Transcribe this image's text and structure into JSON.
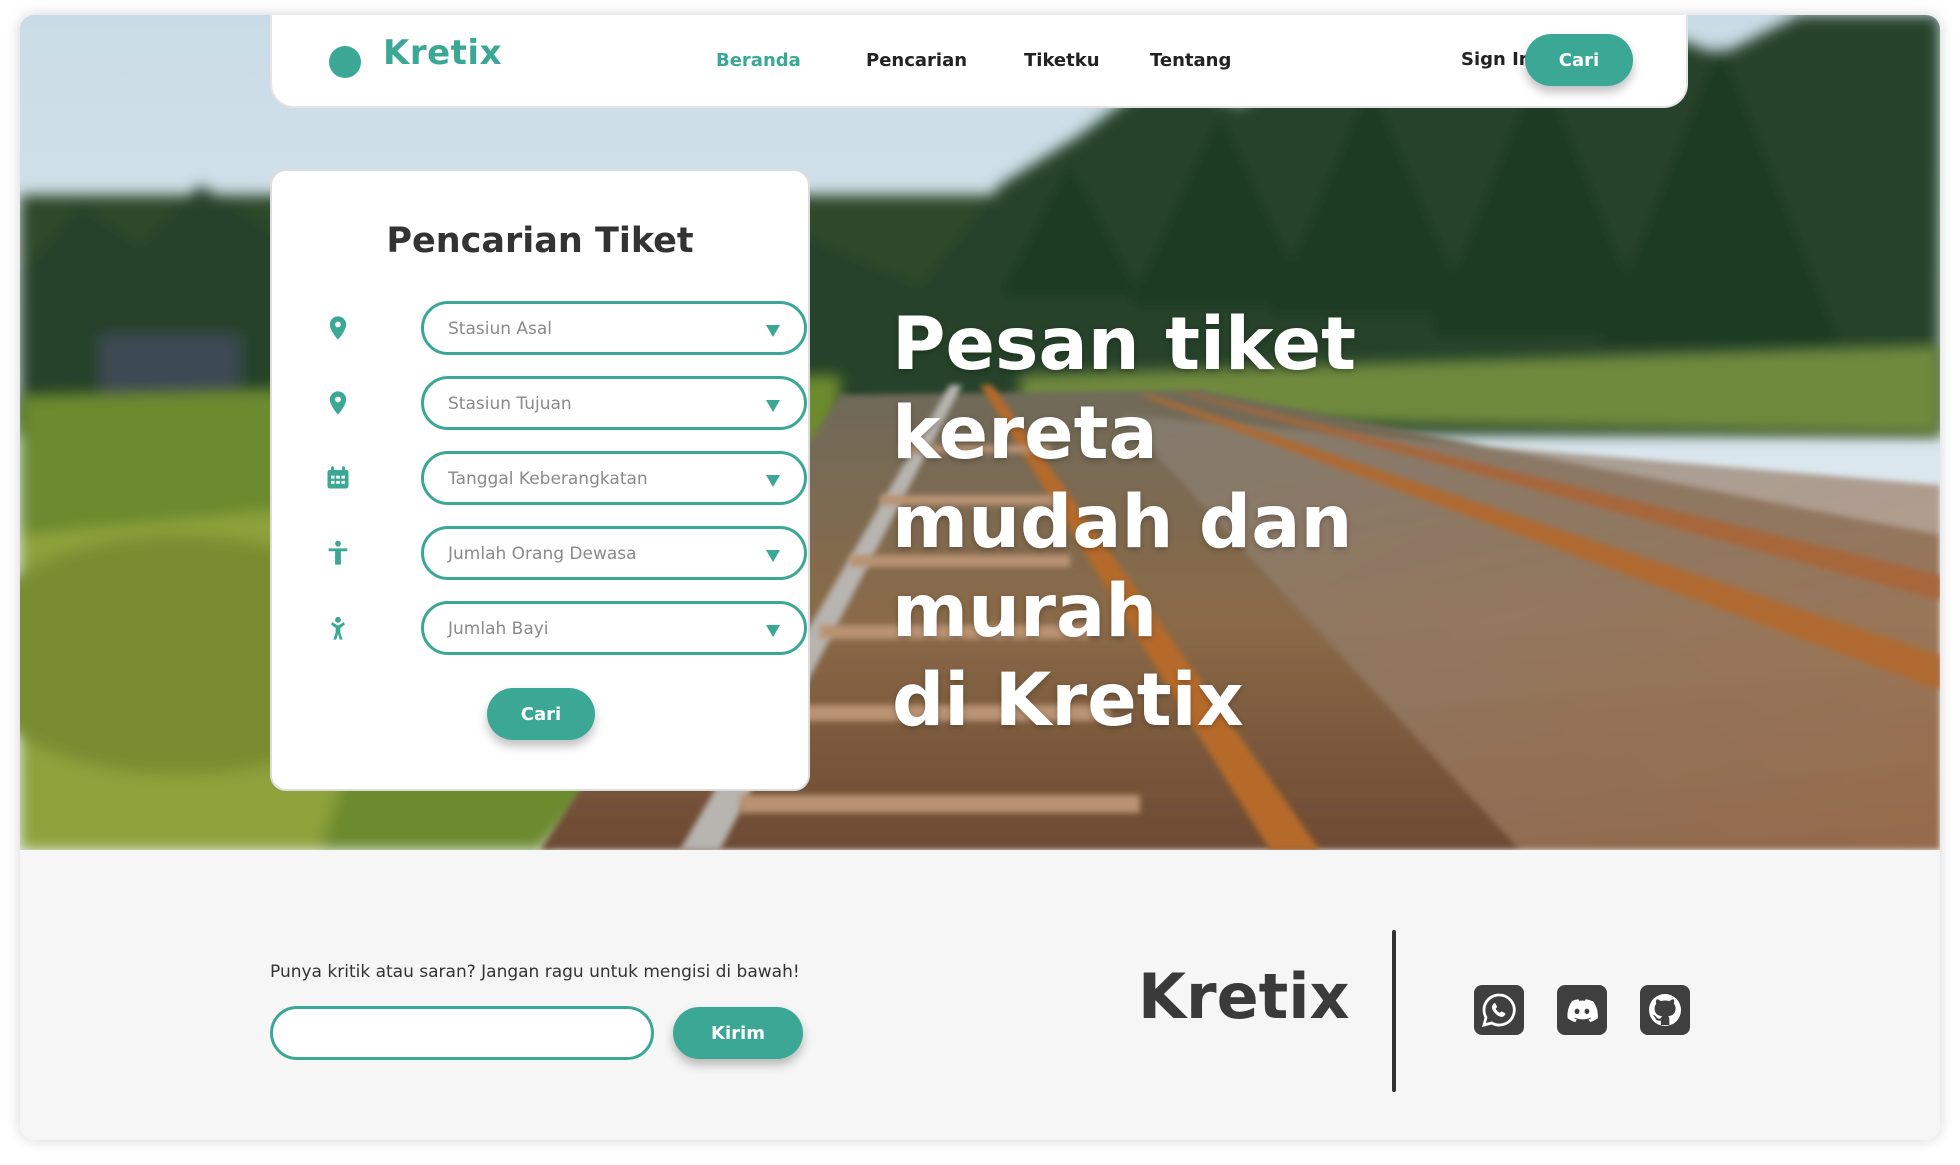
{
  "nav": {
    "brand": "Kretix",
    "links": [
      "Beranda",
      "Pencarian",
      "Tiketku",
      "Tentang"
    ],
    "signin_label": "Sign In",
    "cari_label": "Cari"
  },
  "search_card": {
    "title": "Pencarian Tiket",
    "fields": [
      {
        "placeholder": "Stasiun Asal",
        "icon": "location-pin-icon"
      },
      {
        "placeholder": "Stasiun Tujuan",
        "icon": "location-pin-icon"
      },
      {
        "placeholder": "Tanggal Keberangkatan",
        "icon": "calendar-icon"
      },
      {
        "placeholder": "Jumlah Orang Dewasa",
        "icon": "adult-person-icon"
      },
      {
        "placeholder": "Jumlah Bayi",
        "icon": "child-person-icon"
      }
    ],
    "submit_label": "Cari"
  },
  "hero": {
    "headline_lines": [
      "Pesan tiket kereta",
      "mudah dan murah",
      "di Kretix"
    ]
  },
  "footer": {
    "feedback_label": "Punya kritik atau saran? Jangan ragu untuk mengisi di bawah!",
    "feedback_placeholder": "",
    "send_label": "Kirim",
    "brand": "Kretix",
    "socials": [
      "whatsapp-icon",
      "discord-icon",
      "github-icon"
    ]
  },
  "colors": {
    "accent": "#3ba896",
    "text_dark": "#333333",
    "footer_bg": "#f6f6f6"
  }
}
